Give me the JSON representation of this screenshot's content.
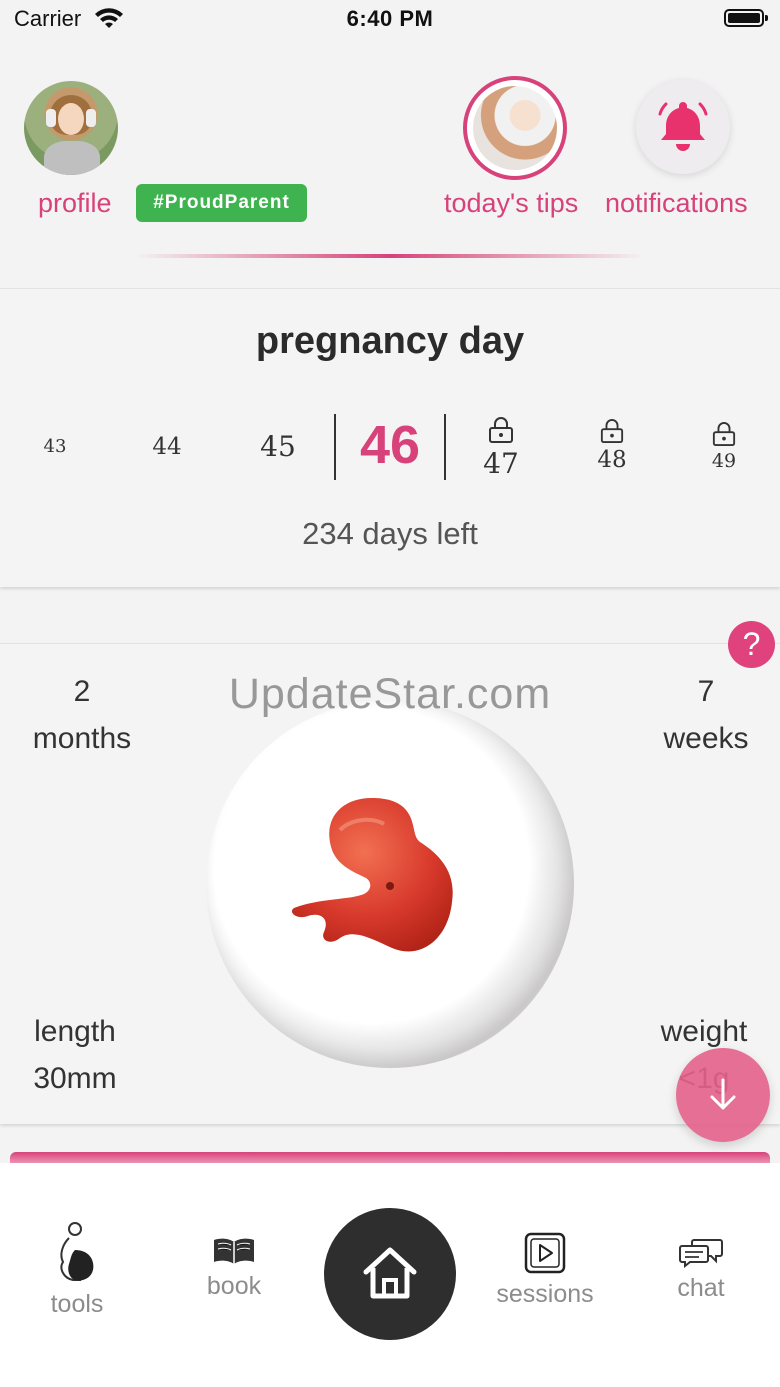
{
  "status_bar": {
    "carrier": "Carrier",
    "time": "6:40 PM"
  },
  "header": {
    "profile_label": "profile",
    "tag": "#ProudParent",
    "tips_label": "today's tips",
    "notifications_label": "notifications"
  },
  "pregnancy": {
    "title": "pregnancy day",
    "days": [
      "43",
      "44",
      "45",
      "46",
      "47",
      "48",
      "49"
    ],
    "current_day": "46",
    "days_left": "234 days left"
  },
  "baby": {
    "watermark": "UpdateStar.com",
    "months_value": "2",
    "months_label": "months",
    "weeks_value": "7",
    "weeks_label": "weeks",
    "length_label": "length",
    "length_value": "30mm",
    "weight_label": "weight",
    "weight_value": "<1g",
    "help": "?"
  },
  "tabs": {
    "tools": "tools",
    "book": "book",
    "sessions": "sessions",
    "chat": "chat"
  },
  "colors": {
    "accent": "#d8427a",
    "tag_green": "#3fb34f",
    "home_dark": "#2e2e2e"
  },
  "icons": [
    "wifi-icon",
    "battery-icon",
    "bell-icon",
    "lock-icon",
    "question-icon",
    "arrow-down-icon",
    "pregnant-icon",
    "book-icon",
    "home-icon",
    "play-icon",
    "chat-icon"
  ]
}
